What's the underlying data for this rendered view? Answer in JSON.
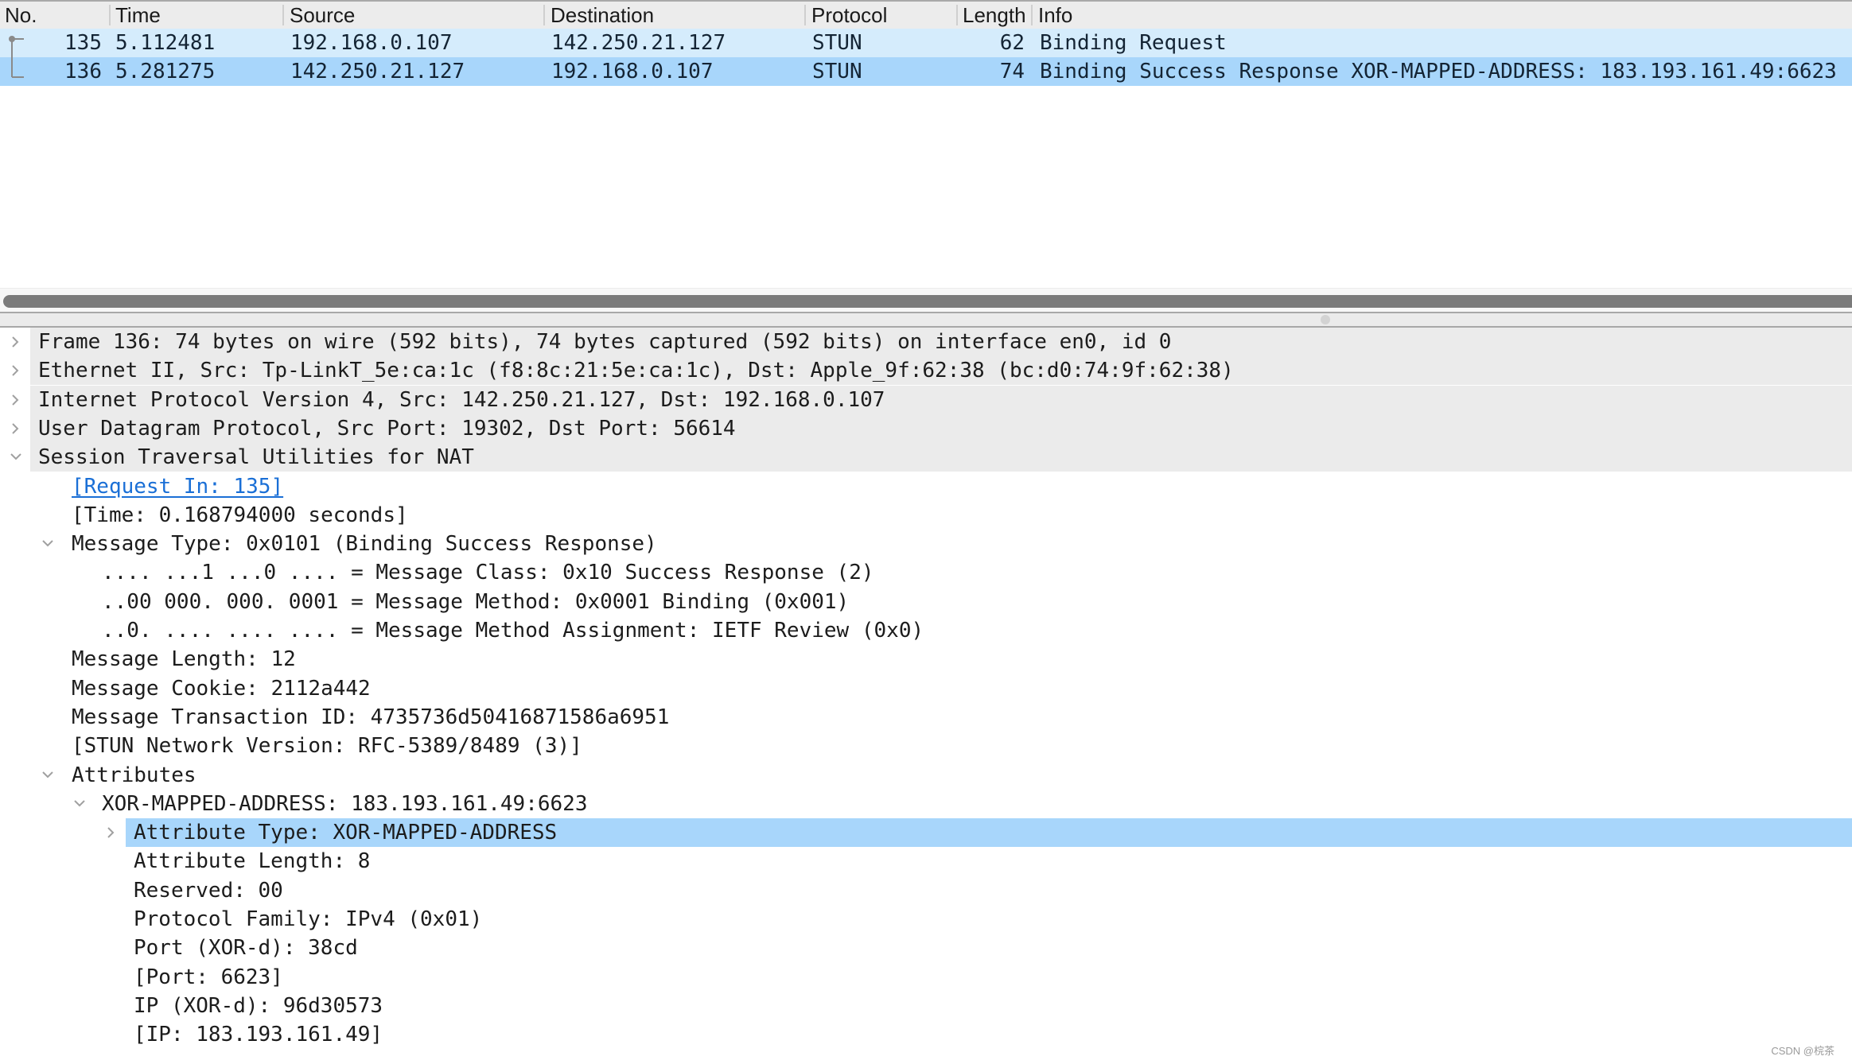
{
  "packet_list": {
    "columns": [
      {
        "key": "no",
        "label": "No."
      },
      {
        "key": "time",
        "label": "Time"
      },
      {
        "key": "source",
        "label": "Source"
      },
      {
        "key": "destination",
        "label": "Destination"
      },
      {
        "key": "protocol",
        "label": "Protocol"
      },
      {
        "key": "length",
        "label": "Length"
      },
      {
        "key": "info",
        "label": "Info"
      }
    ],
    "rows": [
      {
        "no": "135",
        "time": "5.112481",
        "source": "192.168.0.107",
        "destination": "142.250.21.127",
        "protocol": "STUN",
        "length": "62",
        "info": "Binding Request",
        "related_marker": "request"
      },
      {
        "no": "136",
        "time": "5.281275",
        "source": "142.250.21.127",
        "destination": "192.168.0.107",
        "protocol": "STUN",
        "length": "74",
        "info": "Binding Success Response XOR-MAPPED-ADDRESS: 183.193.161.49:6623",
        "related_marker": "response",
        "selected": true
      }
    ]
  },
  "detail_tree": {
    "rows": [
      {
        "level": 0,
        "arrow": "collapsed",
        "text": "Frame 136: 74 bytes on wire (592 bits), 74 bytes captured (592 bits) on interface en0, id 0"
      },
      {
        "level": 0,
        "arrow": "collapsed",
        "text": "Ethernet II, Src: Tp-LinkT_5e:ca:1c (f8:8c:21:5e:ca:1c), Dst: Apple_9f:62:38 (bc:d0:74:9f:62:38)"
      },
      {
        "level": 0,
        "arrow": "collapsed",
        "text": "Internet Protocol Version 4, Src: 142.250.21.127, Dst: 192.168.0.107"
      },
      {
        "level": 0,
        "arrow": "collapsed",
        "text": "User Datagram Protocol, Src Port: 19302, Dst Port: 56614"
      },
      {
        "level": 0,
        "arrow": "expanded",
        "text": "Session Traversal Utilities for NAT"
      },
      {
        "level": 1,
        "arrow": "none",
        "text": "[Request In: 135]",
        "link": true
      },
      {
        "level": 1,
        "arrow": "none",
        "text": "[Time: 0.168794000 seconds]"
      },
      {
        "level": 1,
        "arrow": "expanded",
        "text": "Message Type: 0x0101 (Binding Success Response)"
      },
      {
        "level": 2,
        "arrow": "none",
        "text": ".... ...1 ...0 .... = Message Class: 0x10 Success Response (2)"
      },
      {
        "level": 2,
        "arrow": "none",
        "text": "..00 000. 000. 0001 = Message Method: 0x0001 Binding (0x001)"
      },
      {
        "level": 2,
        "arrow": "none",
        "text": "..0. .... .... .... = Message Method Assignment: IETF Review (0x0)"
      },
      {
        "level": 1,
        "arrow": "none",
        "text": "Message Length: 12"
      },
      {
        "level": 1,
        "arrow": "none",
        "text": "Message Cookie: 2112a442"
      },
      {
        "level": 1,
        "arrow": "none",
        "text": "Message Transaction ID: 4735736d50416871586a6951"
      },
      {
        "level": 1,
        "arrow": "none",
        "text": "[STUN Network Version: RFC-5389/8489 (3)]"
      },
      {
        "level": 1,
        "arrow": "expanded",
        "text": "Attributes"
      },
      {
        "level": 2,
        "arrow": "expanded",
        "text": "XOR-MAPPED-ADDRESS: 183.193.161.49:6623"
      },
      {
        "level": 3,
        "arrow": "collapsed",
        "text": "Attribute Type: XOR-MAPPED-ADDRESS",
        "selected": true
      },
      {
        "level": 3,
        "arrow": "none",
        "text": "Attribute Length: 8"
      },
      {
        "level": 3,
        "arrow": "none",
        "text": "Reserved: 00"
      },
      {
        "level": 3,
        "arrow": "none",
        "text": "Protocol Family: IPv4 (0x01)"
      },
      {
        "level": 3,
        "arrow": "none",
        "text": "Port (XOR-d): 38cd"
      },
      {
        "level": 3,
        "arrow": "none",
        "text": "[Port: 6623]"
      },
      {
        "level": 3,
        "arrow": "none",
        "text": "IP (XOR-d): 96d30573"
      },
      {
        "level": 3,
        "arrow": "none",
        "text": "[IP: 183.193.161.49]"
      }
    ]
  },
  "colors": {
    "header_bg": "#ececec",
    "row_related_bg": "#d5ecfc",
    "row_selected_bg": "#a8d6fb",
    "tree_selected_bg": "#a8d6fb",
    "link": "#1a6fd6",
    "scroll_thumb": "#7b7b7b"
  },
  "watermark": "CSDN @梡茶"
}
